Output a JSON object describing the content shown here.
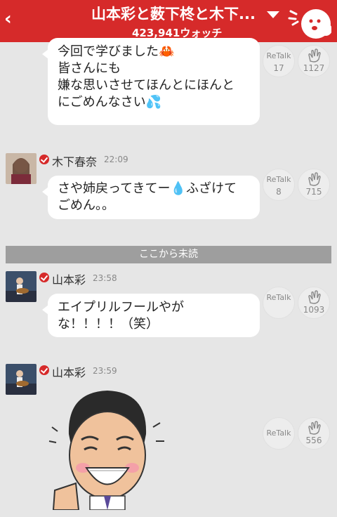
{
  "header": {
    "back_icon": "back-chevron-icon",
    "title": "山本彩と薮下柊と木下...",
    "watch_count": "423,941ウォッチ",
    "menu_icon": "caret-down-icon",
    "mascot_icon": "mascot-ghost-icon",
    "color": "#d62a2a"
  },
  "messages": [
    {
      "lines": [
        "今回で学びました🦀",
        "皆さんにも",
        "嫌な思いさせてほんとにほんと",
        "にごめんなさい💦"
      ],
      "retalk_label": "ReTalk",
      "retalk_count": "17",
      "clap_count": "1127"
    },
    {
      "author": "木下春奈",
      "time": "22:09",
      "lines": [
        "さや姉戻ってきてー💧ふざけて",
        "ごめん。。"
      ],
      "retalk_label": "ReTalk",
      "retalk_count": "8",
      "clap_count": "715"
    },
    {
      "author": "山本彩",
      "time": "23:58",
      "lines": [
        "エイプリルフールやが",
        "な！！！！（笑）"
      ],
      "retalk_label": "ReTalk",
      "clap_count": "1093"
    },
    {
      "author": "山本彩",
      "time": "23:59",
      "sticker_icon": "laughing-caricature-sticker",
      "retalk_label": "ReTalk",
      "clap_count": "556"
    }
  ],
  "unread_divider": "ここから未読",
  "icons": {
    "clap": "clap-hands-icon",
    "verified": "verified-check-icon"
  }
}
